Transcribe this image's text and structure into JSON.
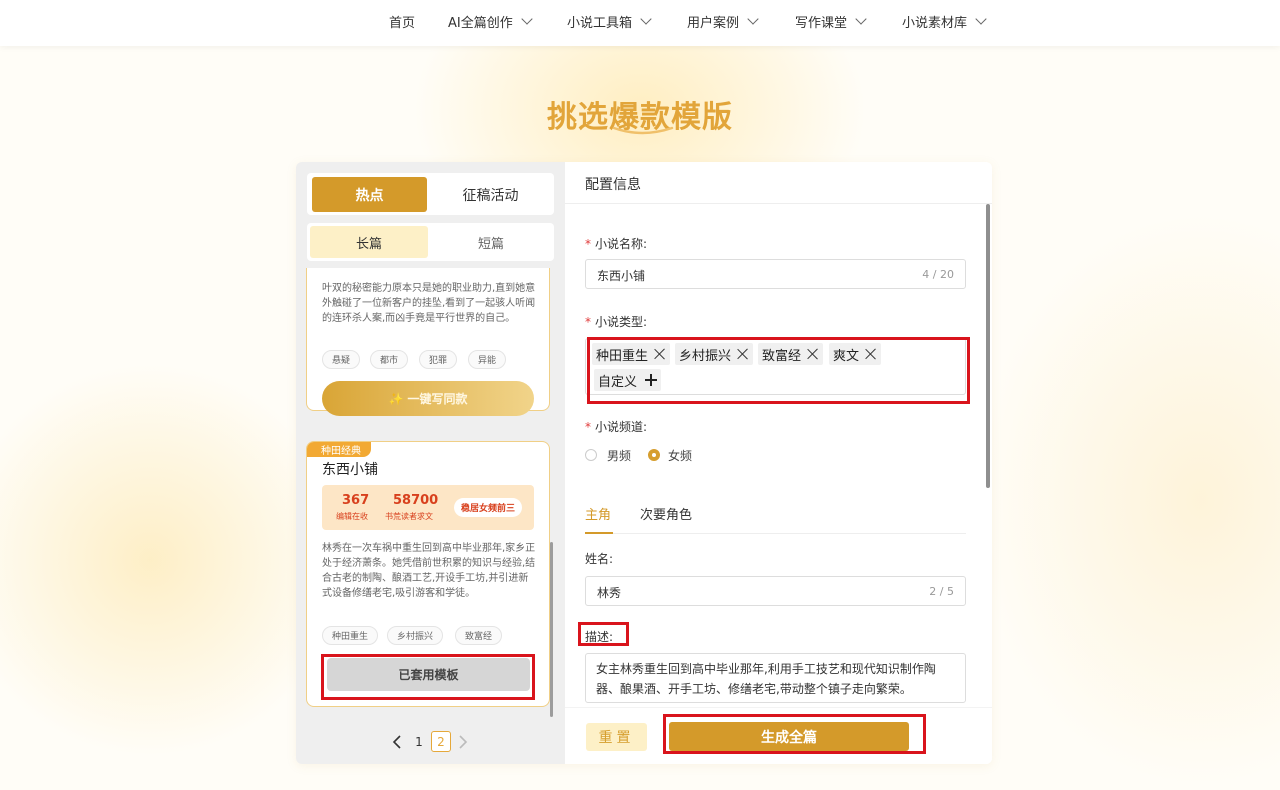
{
  "nav": {
    "items": [
      {
        "label": "首页",
        "has_menu": false
      },
      {
        "label": "AI全篇创作",
        "has_menu": true
      },
      {
        "label": "小说工具箱",
        "has_menu": true
      },
      {
        "label": "用户案例",
        "has_menu": true
      },
      {
        "label": "写作课堂",
        "has_menu": true
      },
      {
        "label": "小说素材库",
        "has_menu": true
      }
    ]
  },
  "page_title": "挑选爆款模版",
  "left_panel": {
    "main_tabs": [
      {
        "label": "热点",
        "active": true
      },
      {
        "label": "征稿活动",
        "active": false
      }
    ],
    "sub_tabs": [
      {
        "label": "长篇",
        "active": true
      },
      {
        "label": "短篇",
        "active": false
      }
    ],
    "cards": [
      {
        "description": "叶双的秘密能力原本只是她的职业助力,直到她意外触碰了一位新客户的挂坠,看到了一起骇人听闻的连环杀人案,而凶手竟是平行世界的自己。",
        "tags": [
          "悬疑",
          "都市",
          "犯罪",
          "异能"
        ],
        "button_label": "✨ 一键写同款"
      },
      {
        "ribbon": "种田经典",
        "title": "东西小铺",
        "stats": [
          {
            "value": "367",
            "label": "编辑在收"
          },
          {
            "value": "58700",
            "label": "书荒读者求文"
          }
        ],
        "rank_badge": "稳居女频前三",
        "description": "林秀在一次车祸中重生回到高中毕业那年,家乡正处于经济萧条。她凭借前世积累的知识与经验,结合古老的制陶、酿酒工艺,开设手工坊,并引进新式设备修缮老宅,吸引游客和学徒。",
        "tags": [
          "种田重生",
          "乡村振兴",
          "致富经"
        ],
        "button_label": "已套用模板"
      }
    ],
    "pagination": {
      "pages": [
        "1",
        "2"
      ],
      "current": "2"
    }
  },
  "config": {
    "header": "配置信息",
    "novel_name": {
      "label": "小说名称:",
      "value": "东西小铺",
      "count": "4 / 20"
    },
    "novel_type": {
      "label": "小说类型:",
      "chips": [
        "种田重生",
        "乡村振兴",
        "致富经",
        "爽文"
      ],
      "custom_label": "自定义"
    },
    "channel": {
      "label": "小说频道:",
      "options": [
        {
          "label": "男频",
          "selected": false
        },
        {
          "label": "女频",
          "selected": true
        }
      ]
    },
    "role_tabs": [
      {
        "label": "主角",
        "active": true
      },
      {
        "label": "次要角色",
        "active": false
      }
    ],
    "name_field": {
      "label": "姓名:",
      "value": "林秀",
      "count": "2 / 5"
    },
    "desc_field": {
      "label": "描述:",
      "value": "女主林秀重生回到高中毕业那年,利用手工技艺和现代知识制作陶器、酿果酒、开手工坊、修缮老宅,带动整个镇子走向繁荣。"
    },
    "footer": {
      "reset_label": "重置",
      "generate_label": "生成全篇"
    }
  },
  "colors": {
    "accent": "#d49a2a",
    "title": "#e2a53a",
    "highlight": "#d9141c",
    "required": "#e03a3a"
  }
}
